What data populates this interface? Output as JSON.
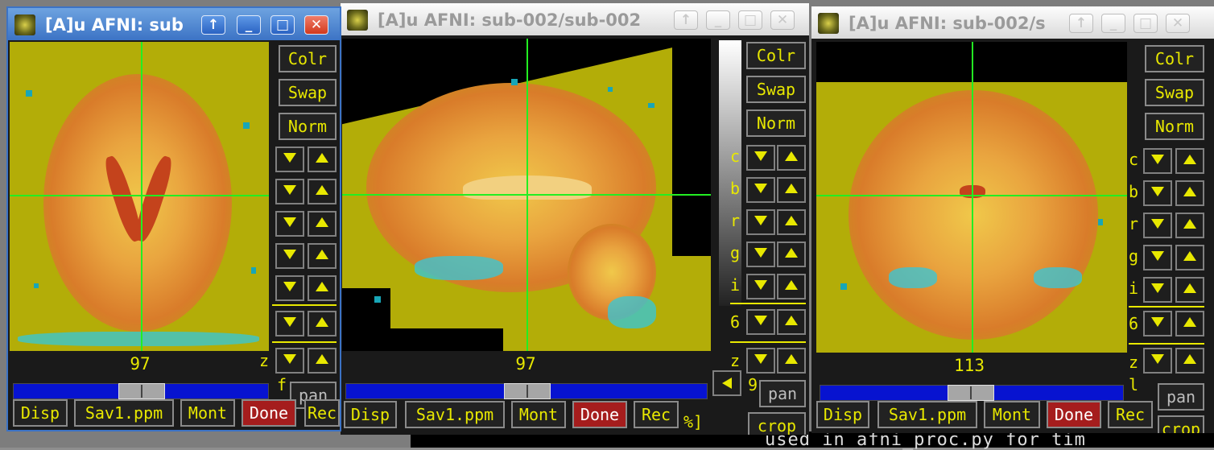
{
  "colors": {
    "overlay_yellow": "#b3ad08",
    "crosshair": "#22ee22",
    "button_text": "#e8e800",
    "done_button": "#a51d1d",
    "slider_blue": "#0713d0",
    "active_titlebar": "#3c73c5"
  },
  "background": {
    "terminal_text": "used in afni_proc.py for tim"
  },
  "windows": [
    {
      "title": "[A]u AFNI: sub",
      "view": "axial",
      "active": true,
      "slice_number": "97",
      "slider_fraction": 0.5,
      "side_buttons": {
        "colr": "Colr",
        "swap": "Swap",
        "norm": "Norm"
      },
      "bottom": {
        "disp": "Disp",
        "save": "Sav1.ppm",
        "mont": "Mont",
        "done": "Done",
        "rec": "Rec"
      },
      "side_labels": {
        "z": "z",
        "f": "f",
        "pan": "pan"
      }
    },
    {
      "title": "[A]u AFNI: sub-002/sub-002",
      "view": "sagittal",
      "active": false,
      "slice_number": "97",
      "slider_fraction": 0.5,
      "side_buttons": {
        "colr": "Colr",
        "swap": "Swap",
        "norm": "Norm"
      },
      "bottom": {
        "disp": "Disp",
        "save": "Sav1.ppm",
        "mont": "Mont",
        "done": "Done",
        "rec": "Rec",
        "extra": "%]"
      },
      "side_labels": {
        "c": "c",
        "b": "b",
        "r": "r",
        "g": "g",
        "i": "i",
        "six": "6",
        "z": "z",
        "pan": "pan",
        "crop": "crop",
        "nine": "9"
      }
    },
    {
      "title": "[A]u AFNI: sub-002/s",
      "view": "coronal",
      "active": false,
      "slice_number": "113",
      "slider_fraction": 0.5,
      "side_buttons": {
        "colr": "Colr",
        "swap": "Swap",
        "norm": "Norm"
      },
      "bottom": {
        "disp": "Disp",
        "save": "Sav1.ppm",
        "mont": "Mont",
        "done": "Done",
        "rec": "Rec"
      },
      "side_labels": {
        "c": "c",
        "b": "b",
        "r": "r",
        "g": "g",
        "i": "i",
        "six": "6",
        "z": "z",
        "l": "l",
        "pan": "pan",
        "crop": "crop"
      }
    }
  ],
  "icons": {
    "title_arrow": "↑",
    "minimize": "_",
    "maximize": "□",
    "close": "✕"
  }
}
